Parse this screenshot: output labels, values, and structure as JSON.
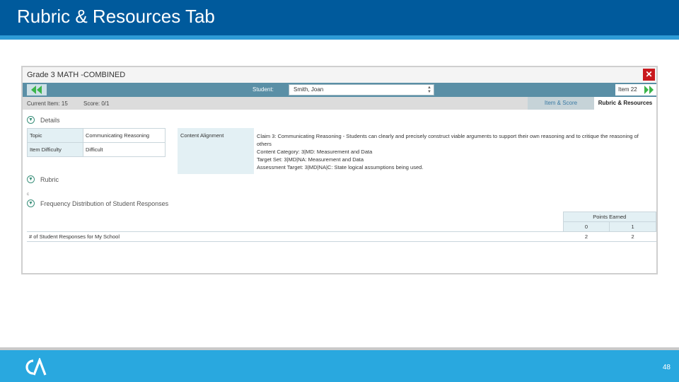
{
  "slide": {
    "title": "Rubric & Resources Tab",
    "page_number": "48"
  },
  "app": {
    "title": "Grade 3 MATH -COMBINED",
    "student_label": "Student:",
    "student_value": "Smith, Joan",
    "item_label": "Item 22",
    "current_item": "Current Item: 15",
    "score": "Score: 0/1",
    "tabs": [
      {
        "label": "Item & Score",
        "active": false
      },
      {
        "label": "Rubric & Resources",
        "active": true
      }
    ],
    "details_heading": "Details",
    "details": [
      {
        "key": "Topic",
        "value": "Communicating Reasoning"
      },
      {
        "key": "Item Difficulty",
        "value": "Difficult"
      }
    ],
    "content_alignment_label": "Content Alignment",
    "content_alignment_lines": [
      "Claim 3: Communicating Reasoning - Students can clearly and precisely construct viable arguments to support their own reasoning and to critique the reasoning of",
      "others",
      "Content Category: 3|MD: Measurement and Data",
      "Target Set: 3|MD|NA: Measurement and Data",
      "Assessment Target: 3|MD|NA|C: State logical assumptions being used."
    ],
    "rubric_heading": "Rubric",
    "collapsed_marker": "c",
    "frequency_heading": "Frequency Distribution of Student Responses",
    "frequency": {
      "points_earned_label": "Points Earned",
      "points": [
        "0",
        "1"
      ],
      "row_label": "# of Student Responses for My School",
      "counts": [
        "2",
        "2"
      ]
    }
  },
  "colors": {
    "header_blue": "#005a9c",
    "footer_blue": "#29a8df",
    "nav_teal": "#5a8fa6",
    "close_red": "#c9191e",
    "arrow_green": "#3bb54a"
  },
  "icons": {
    "prev": "double-left-arrow-icon",
    "next": "double-right-arrow-icon",
    "close": "close-icon",
    "section": "chevron-down-circle-icon",
    "logo": "ca-logo"
  }
}
